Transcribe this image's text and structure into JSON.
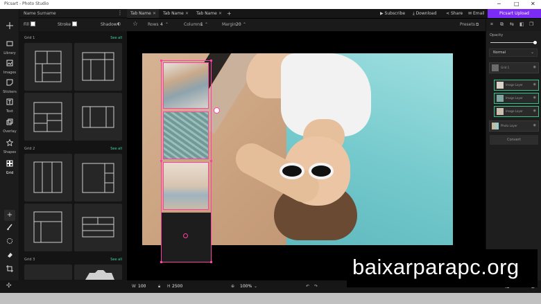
{
  "window": {
    "title": "Picsart - Photo Studio",
    "buttons": {
      "minimize": "─",
      "maximize": "□",
      "close": "✕"
    }
  },
  "left_sidebar": {
    "items": [
      {
        "label": "",
        "icon": "move-icon"
      },
      {
        "label": "Library",
        "icon": "folder-icon"
      },
      {
        "label": "Images",
        "icon": "image-icon"
      },
      {
        "label": "Stickers",
        "icon": "sticker-icon"
      },
      {
        "label": "Text",
        "icon": "text-icon"
      },
      {
        "label": "Overlay",
        "icon": "overlay-icon"
      },
      {
        "label": "Shapes",
        "icon": "star-icon"
      },
      {
        "label": "Grid",
        "icon": "grid-icon"
      }
    ],
    "tools": [
      "plus-icon",
      "brush-icon",
      "lasso-icon",
      "eraser-icon",
      "crop-icon"
    ]
  },
  "panel": {
    "user_name": "Name Surname",
    "fill_label": "Fill",
    "stroke_label": "Stroke",
    "shadow_label": "Shadow",
    "sections": [
      {
        "title": "Grid 1",
        "see_all": "See all"
      },
      {
        "title": "Grid 2",
        "see_all": "See all"
      },
      {
        "title": "Grid 3",
        "see_all": "See all"
      }
    ]
  },
  "tabs": [
    "Tab Name",
    "Tab Name",
    "Tab Name"
  ],
  "header_actions": {
    "subscribe": "Subscribe",
    "download": "Download",
    "share": "Share",
    "email": "Email",
    "upload": "Picsart Upload"
  },
  "toolbar": {
    "rows_label": "Rows",
    "rows_value": "4",
    "columns_label": "Columns",
    "columns_value": "1",
    "margin_label": "Margin",
    "margin_value": "20",
    "presets_label": "Presets"
  },
  "right_panel": {
    "opacity_label": "Opacity",
    "blend_mode": "Normal",
    "layers": [
      {
        "name": "Grid 1"
      },
      {
        "name": "Image Layer"
      },
      {
        "name": "Image Layer"
      },
      {
        "name": "Image Layer"
      },
      {
        "name": "Photo Layer"
      }
    ],
    "button": "Convert"
  },
  "bottom_bar": {
    "width_label": "W",
    "width_value": "100",
    "height_label": "H",
    "height_value": "2500",
    "zoom": "100%"
  },
  "watermark": "baixarparapc.org",
  "colors": {
    "accent": "#7a2bf5",
    "grid_stroke": "#ff3fa5",
    "see_all": "#3fd59a"
  }
}
